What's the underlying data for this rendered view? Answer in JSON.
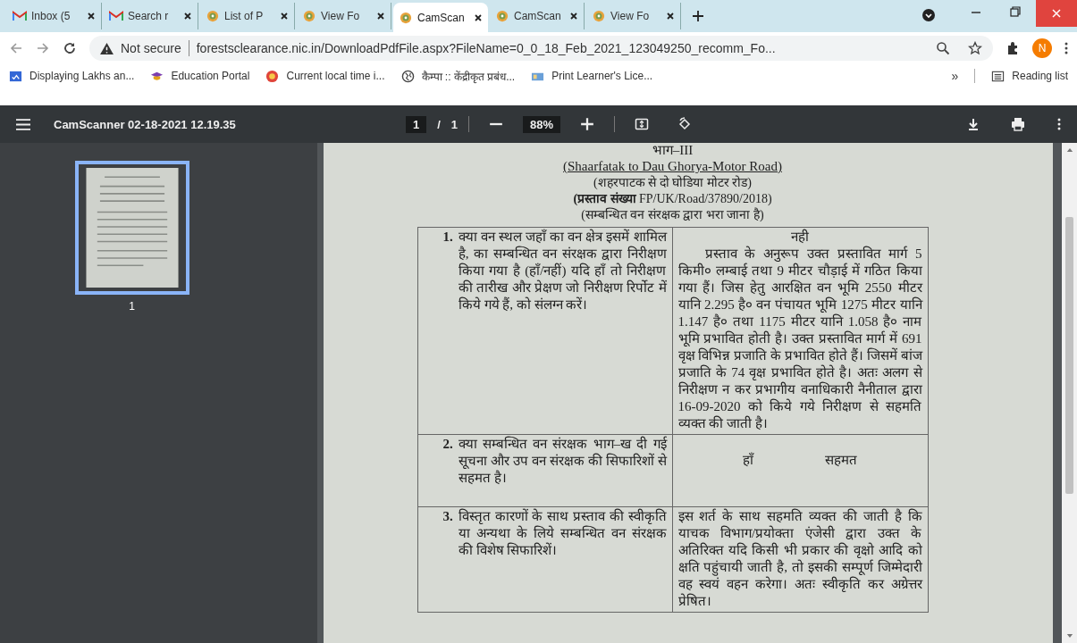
{
  "tabs": [
    {
      "title": "Inbox (5",
      "kind": "gmail",
      "selected": false
    },
    {
      "title": "Search r",
      "kind": "gmail",
      "selected": false
    },
    {
      "title": "List of P",
      "kind": "site",
      "selected": false
    },
    {
      "title": "View Fo",
      "kind": "site",
      "selected": false
    },
    {
      "title": "CamScan",
      "kind": "site",
      "selected": true
    },
    {
      "title": "CamScan",
      "kind": "site",
      "selected": false
    },
    {
      "title": "View Fo",
      "kind": "site",
      "selected": false
    }
  ],
  "address": {
    "security": "Not secure",
    "url": "forestsclearance.nic.in/DownloadPdfFile.aspx?FileName=0_0_18_Feb_2021_123049250_recomm_Fo..."
  },
  "profile": {
    "initial": "N"
  },
  "bookmarks": [
    {
      "label": "Displaying Lakhs an...",
      "kind": "news"
    },
    {
      "label": "Education Portal",
      "kind": "education"
    },
    {
      "label": "Current local time i...",
      "kind": "clock"
    },
    {
      "label": "कैम्पा :: केंद्रीकृत प्रबंध...",
      "kind": "globe"
    },
    {
      "label": "Print Learner's Lice...",
      "kind": "license"
    }
  ],
  "bookmarks_overflow": "»",
  "reading_list": "Reading list",
  "viewer": {
    "title": "CamScanner 02-18-2021 12.19.35",
    "page": "1",
    "separator": "/",
    "total": "1",
    "zoom": "88%",
    "thumbnails": [
      {
        "label": "1",
        "selected": true
      }
    ]
  },
  "document": {
    "heading": "भाग–III",
    "subtitle": "(Shaarfatak to Dau Ghorya-Motor Road)",
    "lines": [
      "(शहरपाटक से दो घोडिया मोटर रोड)",
      "**(प्रस्ताव संख्या** FP/UK/Road/37890/2018)",
      "(सम्बन्धित वन संरक्षक द्वारा भरा जाना है)"
    ],
    "rows": [
      {
        "number": "1.",
        "question": "क्या वन स्थल जहॉं का वन क्षेत्र इसमें शामिल है, का सम्बन्धित वन संरक्षक द्वारा निरीक्षण किया गया है (हॉं/नहीं) यदि हॉं तो निरीक्षण की तारीख और प्रेक्षण जो निरीक्षण रिर्पोट में किये गये हैं, को संलग्न करें।",
        "answer": [
          "नही",
          "प्रस्ताव के अनुरूप उक्त प्रस्तावित मार्ग 5 किमी० लम्बाई तथा 9 मीटर चौड़ाई में गठित किया गया हैं। जिस हेतु आरक्षित वन भूमि 2550 मीटर यानि 2.295 है० वन पंचायत भूमि 1275 मीटर यानि 1.147 है० तथा 1175 मीटर यानि 1.058 है० नाम भूमि प्रभावित होती है। उक्त प्रस्तावित मार्ग में 691 वृक्ष विभिन्न प्रजाति के प्रभावित होते हैं। जिसमें बांज प्रजाति के 74 वृक्ष प्रभावित होते है। अतः अलग से निरीक्षण न कर प्रभागीय वनाधिकारी नैनीताल द्वारा 16-09-2020 को किये गये निरीक्षण से सहमति व्यक्त की जाती है।"
        ]
      },
      {
        "number": "2.",
        "question": "क्या सम्बन्धित वन संरक्षक भाग–ख दी गई सूचना और उप वन संरक्षक की सिफारिशों से सहमत है।",
        "answer": [
          "हॉं",
          "सहमत"
        ]
      },
      {
        "number": "3.",
        "question": "विस्तृत कारणों के साथ प्रस्ताव की स्वीकृति या अन्यथा के लिये सम्बन्धित वन संरक्षक की विशेष सिफारिशें।",
        "answer": [
          "इस शर्त के साथ सहमति व्यक्त की जाती है कि याचक विभाग/प्रयोक्ता एंजेसी द्वारा उक्त के अतिरिक्त यदि किसी भी प्रकार की वृक्षो आदि को क्षति पहुंचायी जाती है, तो इसकी सम्पूर्ण जिम्मेदारी वह स्वयं वहन करेगा। अतः स्वीकृति कर अग्रेत्तर प्रेषित।"
        ]
      }
    ]
  }
}
